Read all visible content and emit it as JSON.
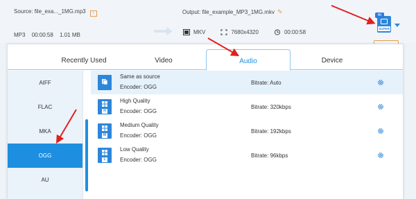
{
  "source": {
    "label": "Source: file_exa..._1MG.mp3"
  },
  "meta": {
    "format": "MP3",
    "duration": "00:00:58",
    "size": "1.01 MB"
  },
  "output": {
    "label": "Output: file_example_MP3_1MG.mkv",
    "format": "MKV",
    "resolution": "7680x4320",
    "duration": "00:00:58"
  },
  "format_button": {
    "badge": "4K",
    "label": "SUPER"
  },
  "tabs": [
    {
      "label": "Recently Used"
    },
    {
      "label": "Video"
    },
    {
      "label": "Audio"
    },
    {
      "label": "Device"
    }
  ],
  "sidebar": {
    "items": [
      {
        "label": "AIFF"
      },
      {
        "label": "FLAC"
      },
      {
        "label": "MKA"
      },
      {
        "label": "OGG"
      },
      {
        "label": "AU"
      }
    ]
  },
  "presets": [
    {
      "name": "Same as source",
      "encoder": "Encoder: OGG",
      "bitrate": "Bitrate: Auto",
      "tag": ""
    },
    {
      "name": "High Quality",
      "encoder": "Encoder: OGG",
      "bitrate": "Bitrate: 320kbps",
      "tag": "H"
    },
    {
      "name": "Medium Quality",
      "encoder": "Encoder: OGG",
      "bitrate": "Bitrate: 192kbps",
      "tag": "M"
    },
    {
      "name": "Low Quality",
      "encoder": "Encoder: OGG",
      "bitrate": "Bitrate: 96kbps",
      "tag": "L"
    }
  ],
  "colors": {
    "accent": "#1e8fe0",
    "annotation": "#e02020",
    "warning": "#e2a04a"
  },
  "icons": [
    "info-icon",
    "arrow-right-icon",
    "pencil-icon",
    "film-icon",
    "resize-icon",
    "clock-icon",
    "gear-icon",
    "preset-icon"
  ]
}
